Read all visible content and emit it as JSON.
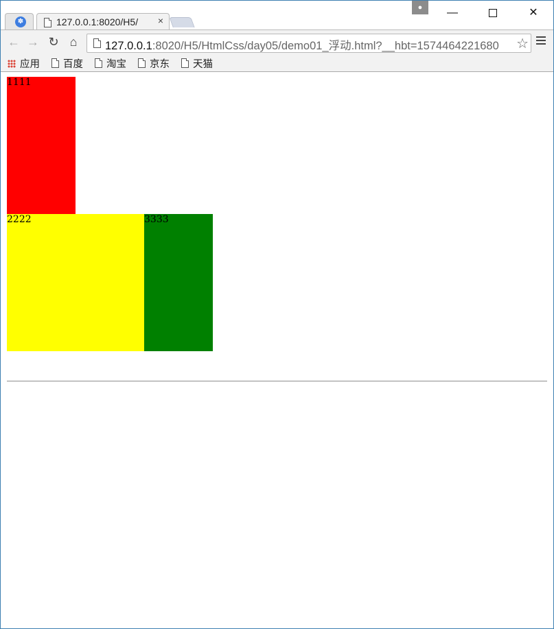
{
  "browser": {
    "tab_title": "127.0.0.1:8020/H5/",
    "tab_close": "×",
    "url_host": "127.0.0.1",
    "url_rest": ":8020/H5/HtmlCss/day05/demo01_浮动.html?__hbt=1574464221680"
  },
  "bookmarks": [
    {
      "label": "应用",
      "icon": "apps-icon"
    },
    {
      "label": "百度",
      "icon": "page-icon"
    },
    {
      "label": "淘宝",
      "icon": "page-icon"
    },
    {
      "label": "京东",
      "icon": "page-icon"
    },
    {
      "label": "天猫",
      "icon": "page-icon"
    }
  ],
  "page": {
    "box1": {
      "text": "1111",
      "color": "#ff0000"
    },
    "box2": {
      "text": "2222",
      "color": "#ffff00"
    },
    "box3": {
      "text": "3333",
      "color": "#008000"
    }
  }
}
